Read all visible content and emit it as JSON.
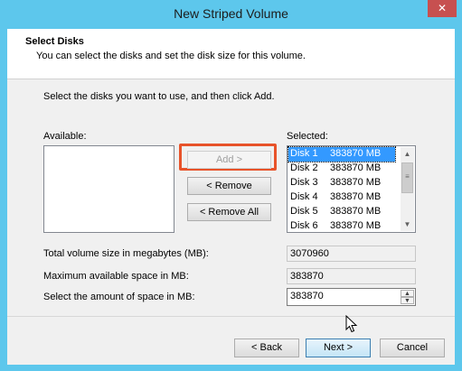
{
  "window": {
    "title": "New Striped Volume",
    "close_glyph": "✕"
  },
  "header": {
    "title": "Select Disks",
    "subtitle": "You can select the disks and set the disk size for this volume."
  },
  "body": {
    "instruction": "Select the disks you want to use, and then click Add.",
    "available_label": "Available:",
    "selected_label": "Selected:",
    "buttons": {
      "add": "Add >",
      "remove": "< Remove",
      "remove_all": "< Remove All"
    },
    "selected_disks": [
      {
        "disk": "Disk 1",
        "size": "383870 MB",
        "selected": true
      },
      {
        "disk": "Disk 2",
        "size": "383870 MB",
        "selected": false
      },
      {
        "disk": "Disk 3",
        "size": "383870 MB",
        "selected": false
      },
      {
        "disk": "Disk 4",
        "size": "383870 MB",
        "selected": false
      },
      {
        "disk": "Disk 5",
        "size": "383870 MB",
        "selected": false
      },
      {
        "disk": "Disk 6",
        "size": "383870 MB",
        "selected": false
      }
    ],
    "total_label": "Total volume size in megabytes (MB):",
    "total_value": "3070960",
    "max_label": "Maximum available space in MB:",
    "max_value": "383870",
    "amount_label": "Select the amount of space in MB:",
    "amount_value": "383870"
  },
  "footer": {
    "back": "< Back",
    "next": "Next >",
    "cancel": "Cancel"
  },
  "colors": {
    "window_frame": "#5dc7ec",
    "highlight": "#e8532a",
    "selection": "#3399ff"
  }
}
